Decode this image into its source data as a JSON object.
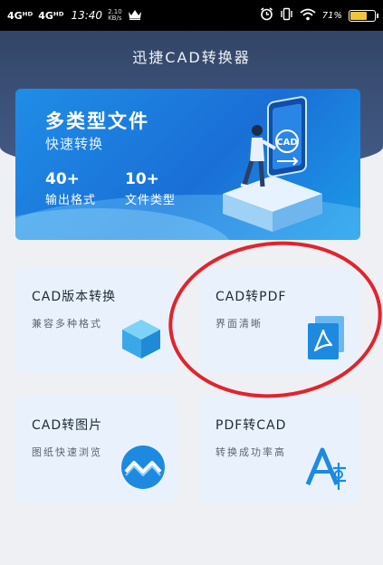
{
  "status_bar": {
    "network_1": "4Gᴴᴰ",
    "network_2": "4Gᴴᴰ",
    "time": "13:40",
    "speed_value": "2.10",
    "speed_unit": "KB/s",
    "battery_percent": "71%",
    "battery_level": 0.71,
    "battery_color": "#f3c43a"
  },
  "header": {
    "title": "迅捷CAD转换器"
  },
  "banner": {
    "heading": "多类型文件",
    "subheading": "快速转换",
    "stats": [
      {
        "value": "40+",
        "label": "输出格式"
      },
      {
        "value": "10+",
        "label": "文件类型"
      }
    ],
    "art_label": "CAD"
  },
  "cards": [
    {
      "title": "CAD版本转换",
      "description": "兼容多种格式",
      "icon": "cube-icon"
    },
    {
      "title": "CAD转PDF",
      "description": "界面清晰",
      "icon": "pdf-icon"
    },
    {
      "title": "CAD转图片",
      "description": "图纸快速浏览",
      "icon": "image-wave-icon"
    },
    {
      "title": "PDF转CAD",
      "description": "转换成功率高",
      "icon": "cad-glyph-icon"
    }
  ],
  "colors": {
    "header_bg": "#3b5077",
    "banner_blue": "#1a6fd6",
    "card_bg": "#e9f2fc",
    "highlight_red": "#e2232c"
  }
}
